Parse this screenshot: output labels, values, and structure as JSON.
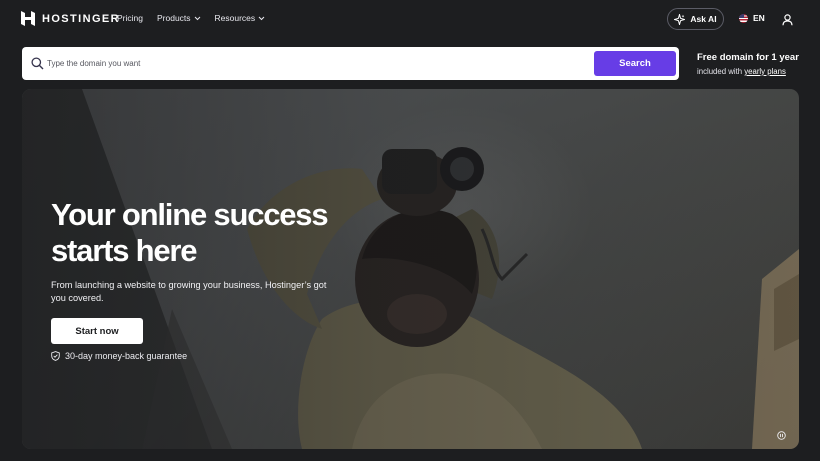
{
  "brand": {
    "name": "HOSTINGER"
  },
  "nav": {
    "items": [
      {
        "label": "Pricing",
        "dropdown": false
      },
      {
        "label": "Products",
        "dropdown": true
      },
      {
        "label": "Resources",
        "dropdown": true
      }
    ],
    "ask_ai": "Ask AI",
    "language": "EN",
    "icons": [
      "chevron-down-icon",
      "ai-sparkle-icon",
      "us-flag-icon",
      "user-icon"
    ]
  },
  "search": {
    "placeholder": "Type the domain you want",
    "value": "",
    "button_label": "Search"
  },
  "promo": {
    "title": "Free domain for 1 year",
    "subtitle_prefix": "included with",
    "subtitle_link": "yearly plans"
  },
  "hero": {
    "title_line1": "Your online success",
    "title_line2": "starts here",
    "subtitle": "From launching a website to growing your business, Hostinger’s got you covered.",
    "cta_label": "Start now",
    "guarantee": "30-day money-back guarantee"
  },
  "colors": {
    "background": "#1d1e20",
    "accent": "#673de6",
    "text": "#ffffff"
  }
}
